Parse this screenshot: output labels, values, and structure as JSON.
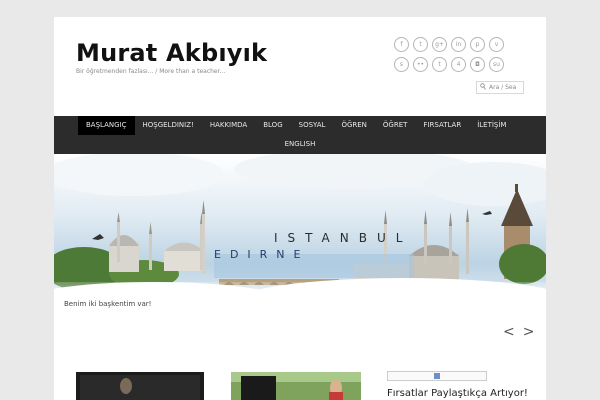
{
  "header": {
    "title": "Murat Akbıyık",
    "tagline": "Bir öğretmenden fazlası... / More than a teacher..."
  },
  "social": {
    "row1": [
      "facebook-icon",
      "twitter-icon",
      "googleplus-icon",
      "linkedin-icon",
      "pinterest-icon",
      "vimeo-icon"
    ],
    "row2": [
      "skype-icon",
      "flickr-icon",
      "tumblr-icon",
      "foursquare-icon",
      "instagram-icon",
      "stumbleupon-icon"
    ],
    "glyphs1": [
      "f",
      "t",
      "g+",
      "in",
      "p",
      "v"
    ],
    "glyphs2": [
      "s",
      "••",
      "t",
      "4",
      "◘",
      "su"
    ]
  },
  "search": {
    "placeholder": "Ara / Sea"
  },
  "nav": {
    "items": [
      "BAŞLANGIÇ",
      "HOŞGELDINIZ!",
      "HAKKIMDA",
      "BLOG",
      "SOSYAL",
      "ÖĞREN",
      "ÖĞRET",
      "FIRSATLAR",
      "İLETİŞİM"
    ],
    "items_row2": [
      "ENGLISH"
    ],
    "active_index": 0
  },
  "slider": {
    "caption": "Benim iki başkentim var!",
    "banner_word1": "ISTANBUL",
    "banner_word2": "EDIRNE",
    "prev": "<",
    "next": ">"
  },
  "widget": {
    "title": "Fırsatlar Paylaştıkça Artıyor!"
  }
}
